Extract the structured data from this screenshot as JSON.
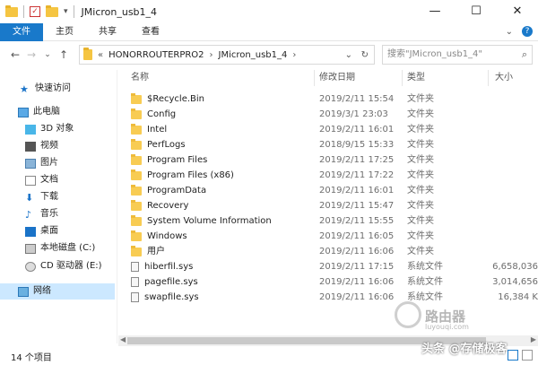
{
  "window": {
    "title": "JMicron_usb1_4",
    "minimize": "—",
    "maximize": "☐",
    "close": "✕"
  },
  "ribbon": {
    "file": "文件",
    "home": "主页",
    "share": "共享",
    "view": "查看",
    "expand": "⌄",
    "help": "?"
  },
  "nav": {
    "back": "←",
    "forward": "→",
    "recent": "⌄",
    "up": "↑"
  },
  "address": {
    "prefix": "«",
    "segments": [
      "HONORROUTERPRO2",
      "JMicron_usb1_4"
    ],
    "separator": "›",
    "dropdown": "⌄",
    "refresh": "↻"
  },
  "search": {
    "placeholder": "搜索\"JMicron_usb1_4\"",
    "icon": "⌕"
  },
  "sidebar": {
    "items": [
      {
        "label": "快速访问",
        "icon": "star-icon"
      },
      {
        "label": "此电脑",
        "icon": "pc-icon"
      },
      {
        "label": "3D 对象",
        "icon": "3d-objects-icon"
      },
      {
        "label": "视频",
        "icon": "video-icon"
      },
      {
        "label": "图片",
        "icon": "pictures-icon"
      },
      {
        "label": "文档",
        "icon": "documents-icon"
      },
      {
        "label": "下载",
        "icon": "download-icon"
      },
      {
        "label": "音乐",
        "icon": "music-icon"
      },
      {
        "label": "桌面",
        "icon": "desktop-icon"
      },
      {
        "label": "本地磁盘 (C:)",
        "icon": "drive-icon"
      },
      {
        "label": "CD 驱动器 (E:)",
        "icon": "cd-drive-icon"
      },
      {
        "label": "网络",
        "icon": "network-icon"
      }
    ]
  },
  "columns": {
    "name": "名称",
    "date": "修改日期",
    "type": "类型",
    "size": "大小"
  },
  "files": [
    {
      "name": "$Recycle.Bin",
      "date": "2019/2/11 15:54",
      "type": "文件夹",
      "size": "",
      "kind": "folder"
    },
    {
      "name": "Config",
      "date": "2019/3/1 23:03",
      "type": "文件夹",
      "size": "",
      "kind": "folder"
    },
    {
      "name": "Intel",
      "date": "2019/2/11 16:01",
      "type": "文件夹",
      "size": "",
      "kind": "folder"
    },
    {
      "name": "PerfLogs",
      "date": "2018/9/15 15:33",
      "type": "文件夹",
      "size": "",
      "kind": "folder"
    },
    {
      "name": "Program Files",
      "date": "2019/2/11 17:25",
      "type": "文件夹",
      "size": "",
      "kind": "folder"
    },
    {
      "name": "Program Files (x86)",
      "date": "2019/2/11 17:22",
      "type": "文件夹",
      "size": "",
      "kind": "folder"
    },
    {
      "name": "ProgramData",
      "date": "2019/2/11 16:01",
      "type": "文件夹",
      "size": "",
      "kind": "folder"
    },
    {
      "name": "Recovery",
      "date": "2019/2/11 15:47",
      "type": "文件夹",
      "size": "",
      "kind": "folder"
    },
    {
      "name": "System Volume Information",
      "date": "2019/2/11 15:55",
      "type": "文件夹",
      "size": "",
      "kind": "folder"
    },
    {
      "name": "Windows",
      "date": "2019/2/11 16:05",
      "type": "文件夹",
      "size": "",
      "kind": "folder"
    },
    {
      "name": "用户",
      "date": "2019/2/11 16:06",
      "type": "文件夹",
      "size": "",
      "kind": "folder"
    },
    {
      "name": "hiberfil.sys",
      "date": "2019/2/11 17:15",
      "type": "系统文件",
      "size": "6,658,036",
      "kind": "sys"
    },
    {
      "name": "pagefile.sys",
      "date": "2019/2/11 16:06",
      "type": "系统文件",
      "size": "3,014,656",
      "kind": "sys"
    },
    {
      "name": "swapfile.sys",
      "date": "2019/2/11 16:06",
      "type": "系统文件",
      "size": "16,384 K",
      "kind": "sys"
    }
  ],
  "status": {
    "count": "14 个项目"
  },
  "watermark": {
    "brand": "路由器",
    "sub": "luyouqi.com",
    "credit": "头条 @存储极客"
  }
}
